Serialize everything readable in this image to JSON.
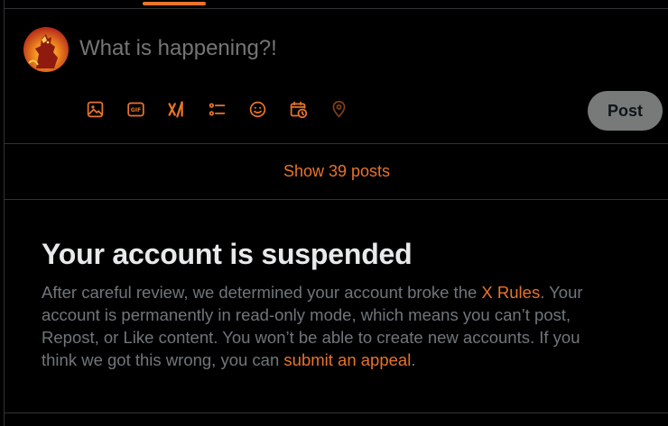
{
  "compose": {
    "placeholder": "What is happening?!",
    "post_label": "Post",
    "toolbar_icons": [
      "image-icon",
      "gif-icon",
      "grok-icon",
      "poll-icon",
      "emoji-icon",
      "schedule-icon",
      "location-icon"
    ]
  },
  "timeline": {
    "show_posts_label": "Show 39 posts"
  },
  "suspension": {
    "title": "Your account is suspended",
    "body_part1": "After careful review, we determined your account broke the ",
    "rules_link": "X Rules",
    "body_part2": ". Your account is permanently in read-only mode, which means you can’t post, Repost, or Like content. You won’t be able to create new accounts. If you think we got this wrong, you can ",
    "appeal_link": "submit an appeal",
    "body_part3": "."
  },
  "colors": {
    "accent": "#e8742a",
    "background": "#000000",
    "text_primary": "#e7e9ea",
    "text_secondary": "#71767b",
    "border": "#2f3336",
    "post_button_disabled": "#787a7a"
  }
}
